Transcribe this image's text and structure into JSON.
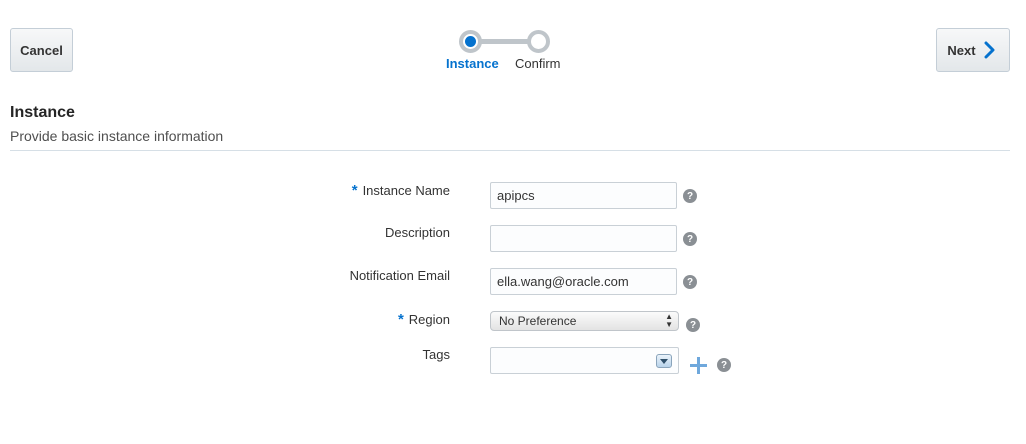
{
  "toolbar": {
    "cancel_label": "Cancel",
    "next_label": "Next"
  },
  "train": {
    "steps": [
      {
        "label": "Instance",
        "state": "current"
      },
      {
        "label": "Confirm",
        "state": "pending"
      }
    ]
  },
  "section": {
    "title": "Instance",
    "subtitle": "Provide basic instance information"
  },
  "form": {
    "instance_name": {
      "label": "Instance Name",
      "required": true,
      "value": "apipcs"
    },
    "description": {
      "label": "Description",
      "required": false,
      "value": ""
    },
    "notification_email": {
      "label": "Notification Email",
      "required": false,
      "value": "ella.wang@oracle.com"
    },
    "region": {
      "label": "Region",
      "required": true,
      "value": "No Preference"
    },
    "tags": {
      "label": "Tags",
      "required": false,
      "value": ""
    },
    "required_marker": "*",
    "help_glyph": "?"
  },
  "colors": {
    "accent": "#0572ce",
    "divider": "#d6dfe6",
    "add_icon": "#6fa8dc"
  },
  "icons": {
    "next": "chevron-right-icon",
    "help": "help-icon",
    "add": "plus-icon",
    "dropdown": "chevron-down-icon"
  }
}
